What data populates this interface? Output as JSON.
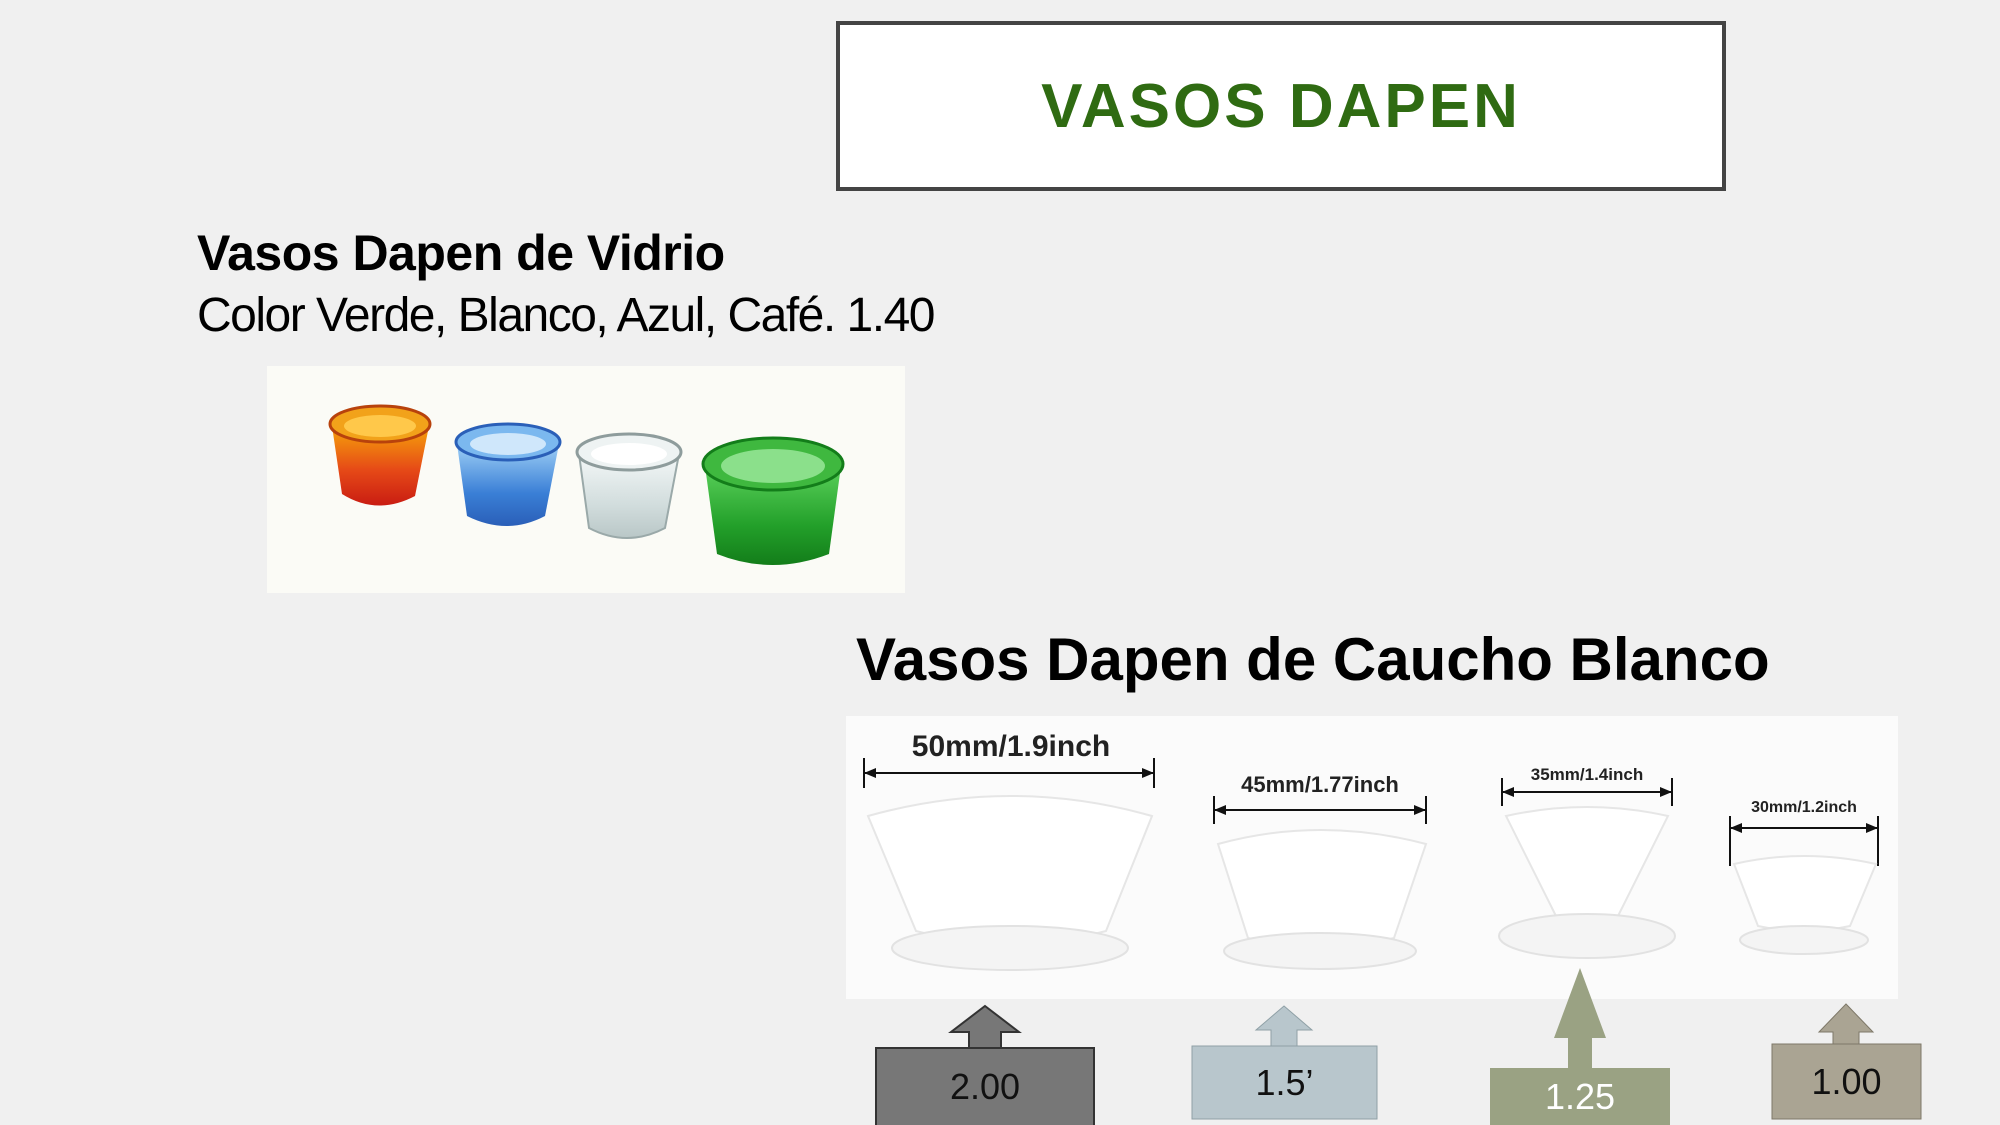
{
  "title": "VASOS DAPEN",
  "glass": {
    "heading": "Vasos Dapen de Vidrio",
    "description": "Color Verde, Blanco, Azul, Café. 1.40"
  },
  "rubber": {
    "heading": "Vasos Dapen de Caucho Blanco",
    "sizes": [
      {
        "dimension": "50mm/1.9inch",
        "price": "2.00",
        "color": "#777777"
      },
      {
        "dimension": "45mm/1.77inch",
        "price": "1.5’",
        "color": "#b8c6cc"
      },
      {
        "dimension": "35mm/1.4inch",
        "price": "1.25",
        "color": "#9aa283"
      },
      {
        "dimension": "30mm/1.2inch",
        "price": "1.00",
        "color": "#aaa493"
      }
    ]
  },
  "colors": {
    "title_text": "#2f6b12",
    "glass_cups": [
      "#e0361a",
      "#3a7fd6",
      "#d9e3e3",
      "#23a02a"
    ]
  }
}
